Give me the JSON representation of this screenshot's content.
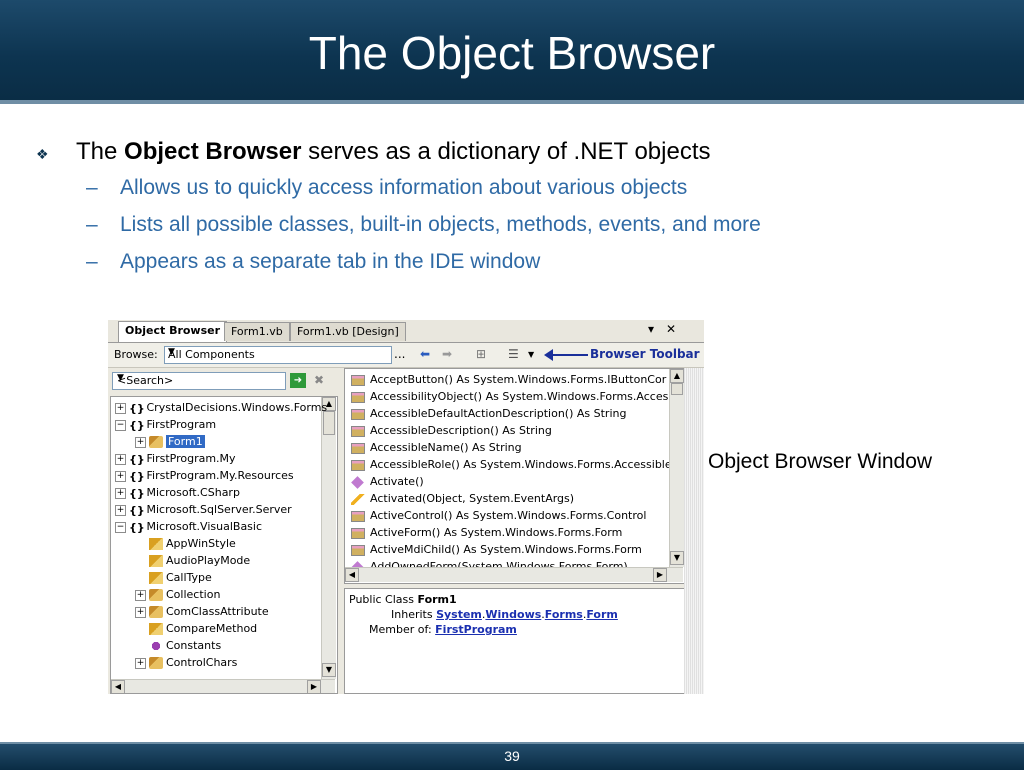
{
  "slide": {
    "title": "The Object Browser",
    "page_number": "39"
  },
  "bullets": {
    "main_prefix": "The ",
    "main_bold": "Object Browser",
    "main_suffix": " serves as a dictionary of .NET objects",
    "subs": [
      "Allows us to quickly access information about various objects",
      "Lists all possible classes, built-in objects, methods, events, and more",
      "Appears as a separate tab in the IDE window"
    ]
  },
  "caption": "Object Browser Window",
  "ide": {
    "tabs": [
      "Object Browser",
      "Form1.vb",
      "Form1.vb [Design]"
    ],
    "controls": {
      "dropdown": "▾",
      "close": "✕"
    },
    "toolbar": {
      "browse_label": "Browse:",
      "browse_value": "All Components",
      "more": "...",
      "annotation": "Browser Toolbar"
    },
    "search": {
      "value": "<Search>"
    },
    "tree": [
      {
        "label": "CrystalDecisions.Windows.Forms",
        "type": "ns",
        "level": 0,
        "expander": "+"
      },
      {
        "label": "FirstProgram",
        "type": "ns",
        "level": 0,
        "expander": "-"
      },
      {
        "label": "Form1",
        "type": "class",
        "level": 1,
        "expander": "+",
        "selected": true
      },
      {
        "label": "FirstProgram.My",
        "type": "ns",
        "level": 0,
        "expander": "+"
      },
      {
        "label": "FirstProgram.My.Resources",
        "type": "ns",
        "level": 0,
        "expander": "+"
      },
      {
        "label": "Microsoft.CSharp",
        "type": "ns",
        "level": 0,
        "expander": "+"
      },
      {
        "label": "Microsoft.SqlServer.Server",
        "type": "ns",
        "level": 0,
        "expander": "+"
      },
      {
        "label": "Microsoft.VisualBasic",
        "type": "ns",
        "level": 0,
        "expander": "-"
      },
      {
        "label": "AppWinStyle",
        "type": "enum",
        "level": 1,
        "expander": ""
      },
      {
        "label": "AudioPlayMode",
        "type": "enum",
        "level": 1,
        "expander": ""
      },
      {
        "label": "CallType",
        "type": "enum",
        "level": 1,
        "expander": ""
      },
      {
        "label": "Collection",
        "type": "class",
        "level": 1,
        "expander": "+"
      },
      {
        "label": "ComClassAttribute",
        "type": "class",
        "level": 1,
        "expander": "+"
      },
      {
        "label": "CompareMethod",
        "type": "enum",
        "level": 1,
        "expander": ""
      },
      {
        "label": "Constants",
        "type": "const",
        "level": 1,
        "expander": ""
      },
      {
        "label": "ControlChars",
        "type": "class",
        "level": 1,
        "expander": "+"
      }
    ],
    "members": [
      {
        "label": "AcceptButton() As System.Windows.Forms.IButtonCor",
        "type": "prop"
      },
      {
        "label": "AccessibilityObject() As System.Windows.Forms.Acces",
        "type": "prop"
      },
      {
        "label": "AccessibleDefaultActionDescription() As String",
        "type": "prop"
      },
      {
        "label": "AccessibleDescription() As String",
        "type": "prop"
      },
      {
        "label": "AccessibleName() As String",
        "type": "prop"
      },
      {
        "label": "AccessibleRole() As System.Windows.Forms.Accessible",
        "type": "prop"
      },
      {
        "label": "Activate()",
        "type": "meth"
      },
      {
        "label": "Activated(Object, System.EventArgs)",
        "type": "evt"
      },
      {
        "label": "ActiveControl() As System.Windows.Forms.Control",
        "type": "prop"
      },
      {
        "label": "ActiveForm() As System.Windows.Forms.Form",
        "type": "prop"
      },
      {
        "label": "ActiveMdiChild() As System.Windows.Forms.Form",
        "type": "prop"
      },
      {
        "label": "AddOwnedForm(System.Windows.Forms.Form)",
        "type": "meth"
      }
    ],
    "detail": {
      "prefix": "Public Class ",
      "class_name": "Form1",
      "inherits_label": "Inherits ",
      "inherits_parts": [
        "System",
        "Windows",
        "Forms",
        "Form"
      ],
      "member_label": "Member of: ",
      "member_value": "FirstProgram"
    }
  }
}
